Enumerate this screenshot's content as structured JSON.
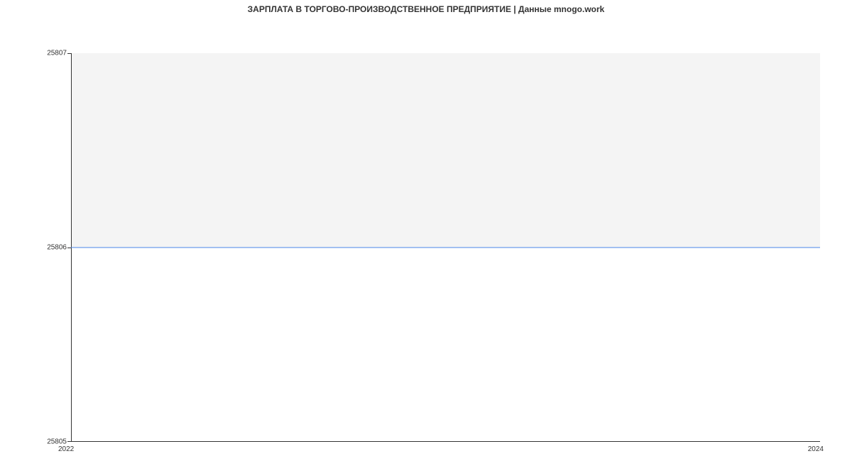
{
  "chart_data": {
    "type": "line",
    "title": "ЗАРПЛАТА В ТОРГОВО-ПРОИЗВОДСТВЕННОЕ ПРЕДПРИЯТИЕ | Данные mnogo.work",
    "x": [
      2022,
      2024
    ],
    "values": [
      25806,
      25806
    ],
    "xlabel": "",
    "ylabel": "",
    "x_ticks": [
      2022,
      2024
    ],
    "y_ticks": [
      25805,
      25806,
      25807
    ],
    "xlim": [
      2022,
      2024
    ],
    "ylim": [
      25805,
      25807
    ],
    "line_color": "#4a86e8"
  },
  "labels": {
    "y_25807": "25807",
    "y_25806": "25806",
    "y_25805": "25805",
    "x_2022": "2022",
    "x_2024": "2024"
  }
}
